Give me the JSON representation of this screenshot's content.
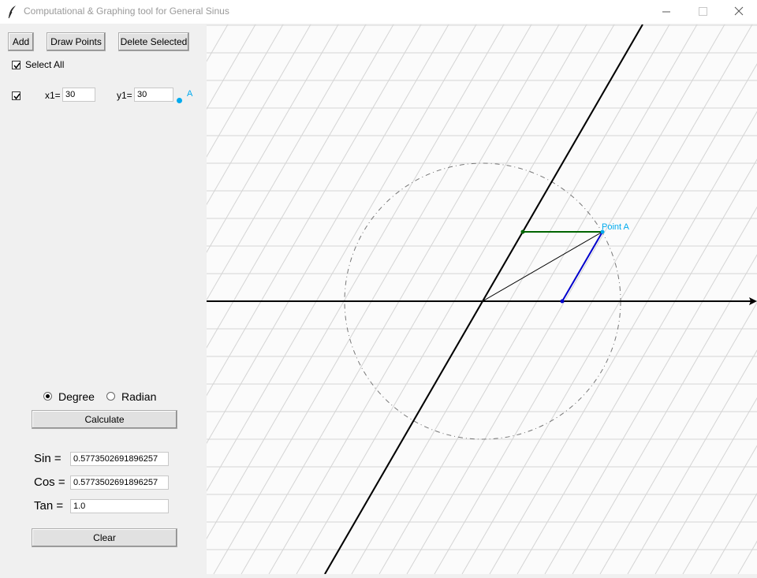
{
  "window": {
    "title": "Computational & Graphing tool for General Sinus",
    "minimize_icon": "minimize-icon",
    "maximize_icon": "maximize-icon",
    "close_icon": "close-icon",
    "app_icon": "feather-icon"
  },
  "toolbar": {
    "add_label": "Add",
    "draw_label": "Draw Points",
    "delete_label": "Delete Selected"
  },
  "select_all": {
    "label": "Select All",
    "checked": true
  },
  "points": [
    {
      "checked": true,
      "x_label": "x1=",
      "x_value": "30",
      "y_label": "y1=",
      "y_value": "30",
      "marker_label": "A",
      "marker_color": "#00aaee"
    }
  ],
  "unit": {
    "degree_label": "Degree",
    "radian_label": "Radian",
    "selected": "Degree"
  },
  "calculate_label": "Calculate",
  "results": {
    "sin_label": "Sin =",
    "sin_value": "0.5773502691896257",
    "cos_label": "Cos =",
    "cos_value": "0.5773502691896257",
    "tan_label": "Tan =",
    "tan_value": "1.0"
  },
  "clear_label": "Clear",
  "graph": {
    "point_label": "Point A",
    "colors": {
      "point": "#00aaee",
      "horizontal_segment": "#006400",
      "vertical_segment": "#0000cc",
      "axes": "#000000",
      "circle": "#777777",
      "grid": "#d4d4d4"
    }
  }
}
